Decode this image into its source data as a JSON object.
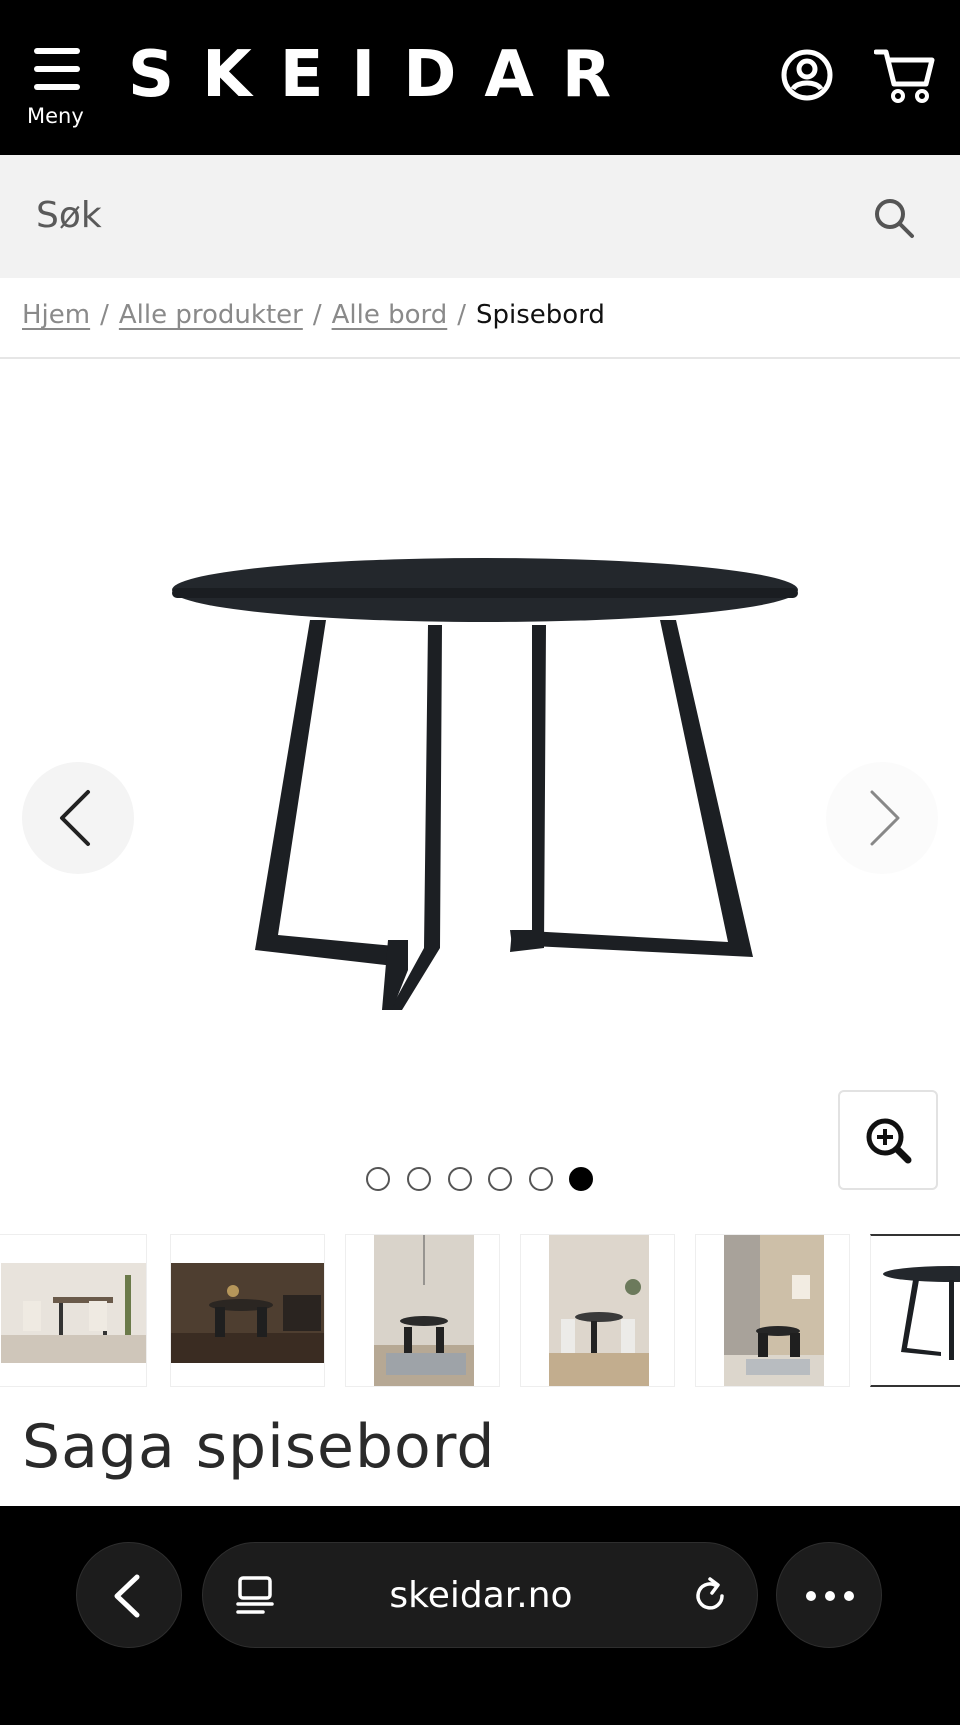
{
  "header": {
    "menu_label": "Meny",
    "logo_text": "SKEIDAR",
    "icons": [
      "menu-icon",
      "account-icon",
      "cart-icon"
    ]
  },
  "search": {
    "placeholder": "Søk",
    "icon": "search-icon"
  },
  "breadcrumb": {
    "items": [
      "Hjem",
      "Alle produkter",
      "Alle bord"
    ],
    "current": "Spisebord",
    "separator": "/"
  },
  "gallery": {
    "slide_count": 6,
    "active_slide": 6,
    "thumbnail_count": 6,
    "icons": [
      "chevron-left-icon",
      "chevron-right-icon",
      "zoom-in-icon"
    ]
  },
  "product": {
    "title": "Saga spisebord"
  },
  "browser": {
    "url": "skeidar.no",
    "icons": [
      "back-icon",
      "tabs-icon",
      "reload-icon",
      "more-icon"
    ]
  },
  "colors": {
    "header_bg": "#000000",
    "search_bg": "#f2f2f2",
    "table_color": "#1f2328"
  }
}
